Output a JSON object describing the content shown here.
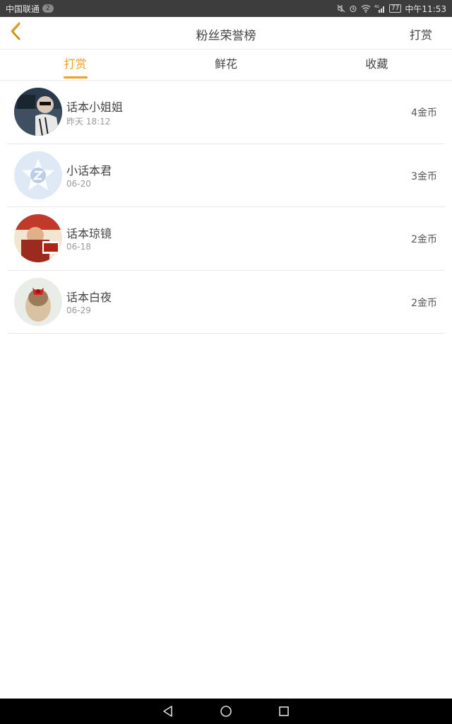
{
  "status_bar": {
    "carrier": "中国联通",
    "sim_badge": "2",
    "network": "4G",
    "battery": "77",
    "time": "中午11:53"
  },
  "header": {
    "title": "粉丝荣誉榜",
    "action_label": "打赏",
    "back_icon": "chevron-left-icon",
    "accent_color": "#f0a020"
  },
  "tabs": [
    {
      "label": "打赏",
      "active": true
    },
    {
      "label": "鲜花",
      "active": false
    },
    {
      "label": "收藏",
      "active": false
    }
  ],
  "list": [
    {
      "name": "话本小姐姐",
      "time": "昨天 18:12",
      "coins": "4金币"
    },
    {
      "name": "小话本君",
      "time": "06-20",
      "coins": "3金币"
    },
    {
      "name": "话本琼镜",
      "time": "06-18",
      "coins": "2金币"
    },
    {
      "name": "话本白夜",
      "time": "06-29",
      "coins": "2金币"
    }
  ],
  "nav_bar": {
    "back": "back-triangle-icon",
    "home": "home-circle-icon",
    "recents": "recents-square-icon"
  }
}
